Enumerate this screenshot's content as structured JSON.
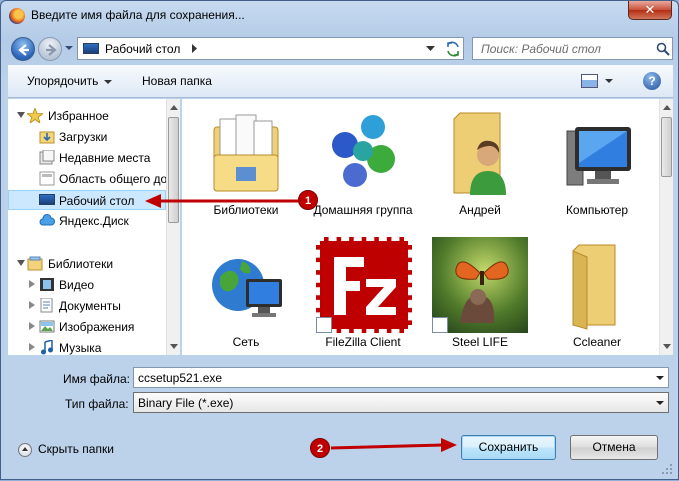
{
  "window": {
    "title": "Введите имя файла для сохранения..."
  },
  "nav": {
    "address": "Рабочий стол",
    "search_placeholder": "Поиск: Рабочий стол"
  },
  "toolbar": {
    "organize": "Упорядочить",
    "new_folder": "Новая папка"
  },
  "sidebar": {
    "favorites": "Избранное",
    "items": [
      "Загрузки",
      "Недавние места",
      "Область общего до",
      "Рабочий стол",
      "Яндекс.Диск"
    ],
    "libraries": "Библиотеки",
    "lib_items": [
      "Видео",
      "Документы",
      "Изображения",
      "Музыка"
    ]
  },
  "files": [
    {
      "label": "Библиотеки"
    },
    {
      "label": "Домашняя группа"
    },
    {
      "label": "Андрей"
    },
    {
      "label": "Компьютер"
    },
    {
      "label": "Сеть"
    },
    {
      "label": "FileZilla Client"
    },
    {
      "label": "Steel LIFE"
    },
    {
      "label": "Ccleaner"
    }
  ],
  "form": {
    "filename_label": "Имя файла:",
    "filename_value": "ccsetup521.exe",
    "filetype_label": "Тип файла:",
    "filetype_value": "Binary File (*.exe)"
  },
  "footer": {
    "hide_folders": "Скрыть папки",
    "save": "Сохранить",
    "cancel": "Отмена"
  },
  "annotations": {
    "badge1": "1",
    "badge2": "2",
    "arrow_color": "#c00000"
  }
}
